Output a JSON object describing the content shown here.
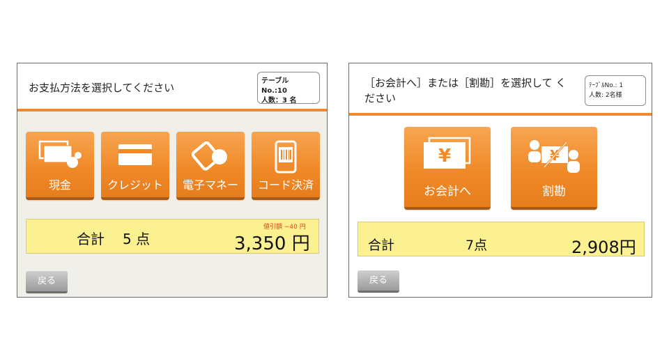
{
  "left_screen": {
    "title": "お支払方法を選択してください",
    "table_info": {
      "line1": "テーブル No.:10",
      "line2": "人数：3 名"
    },
    "buttons": [
      {
        "label": "現金",
        "icon": "cash-icon"
      },
      {
        "label": "クレジット",
        "icon": "credit-card-icon"
      },
      {
        "label": "電子マネー",
        "icon": "e-money-icon"
      },
      {
        "label": "コード決済",
        "icon": "qr-code-payment-icon"
      }
    ],
    "total": {
      "label": "合計",
      "count": "5 点",
      "discount": "値引額 −40 円",
      "amount": "3,350 円"
    },
    "back_label": "戻る"
  },
  "right_screen": {
    "title": "［お会計へ］または［割勘］を選択して ください",
    "table_info": {
      "line1": "ﾃｰﾌﾞﾙNo.:  1",
      "line2": "人数:  2名様"
    },
    "buttons": [
      {
        "label": "お会計へ",
        "icon": "yen-bills-icon"
      },
      {
        "label": "割勘",
        "icon": "split-bill-icon"
      }
    ],
    "total": {
      "label": "合計",
      "count": "7点",
      "amount": "2,908円"
    },
    "back_label": "戻る"
  },
  "colors": {
    "accent": "#f08a29",
    "total_bar": "#fcf190",
    "divider": "#f1892a",
    "back_button": "#a8a8a8"
  }
}
